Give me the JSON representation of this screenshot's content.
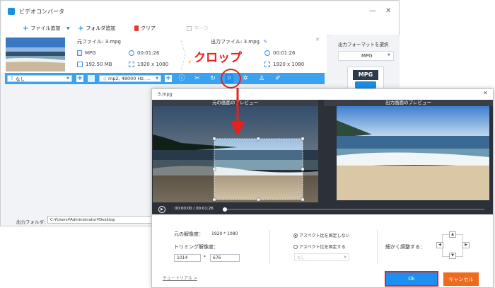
{
  "app": {
    "title": "ビデオコンバータ"
  },
  "window_controls": {
    "minimize": "—",
    "close": "✕"
  },
  "toolbar": {
    "add_file": "ファイル追加",
    "add_folder": "フォルダ追加",
    "clear": "クリア",
    "merge": "マージ"
  },
  "source": {
    "file_label": "元ファイル: 3.mpg",
    "format": "MPG",
    "duration": "00:01:26",
    "size": "192.50 MB",
    "resolution": "1920 x 1080"
  },
  "output": {
    "file_label": "出力ファイル: 3.mpg",
    "duration": "00:01:26",
    "resolution": "1920 x 1080"
  },
  "editbar": {
    "subtitle_select": "なし",
    "audio_select": "mp2, 48000 Hz, ..."
  },
  "sidepanel": {
    "title": "出力フォーマットを選択",
    "format_label": "MPG"
  },
  "output_folder": {
    "label": "出力フォルダ：",
    "path": "C:¥Users¥Administrator¥Desktop"
  },
  "annotation": {
    "crop_text": "クロップ"
  },
  "dialog": {
    "title": "3.mpg",
    "close": "✕",
    "left_preview_title": "元の画面のプレビュー",
    "right_preview_title": "出力画面のプレビュー",
    "time_current": "00:00:00",
    "time_sep": "/",
    "time_total": "00:01:26",
    "original_res_label": "元の解像度：",
    "original_res_value": "1920 * 1080",
    "trim_res_label": "トリミング解像度：",
    "width_value": "1014",
    "height_value": "676",
    "times": "*",
    "radio_keep_no": "アスペクト比を固定しない",
    "radio_keep_yes": "アスペクト比を固定する",
    "ratio_select": "なし",
    "fine_adjust_label": "細かく調整する：",
    "tutorial_link": "チュートリアル >",
    "ok": "Ok",
    "cancel": "キャンセル"
  },
  "colors": {
    "accent_blue": "#3aa2ee",
    "ok_blue": "#1c8ff0",
    "cancel_orange": "#f06a1c",
    "annotation_red": "#e8211c"
  }
}
